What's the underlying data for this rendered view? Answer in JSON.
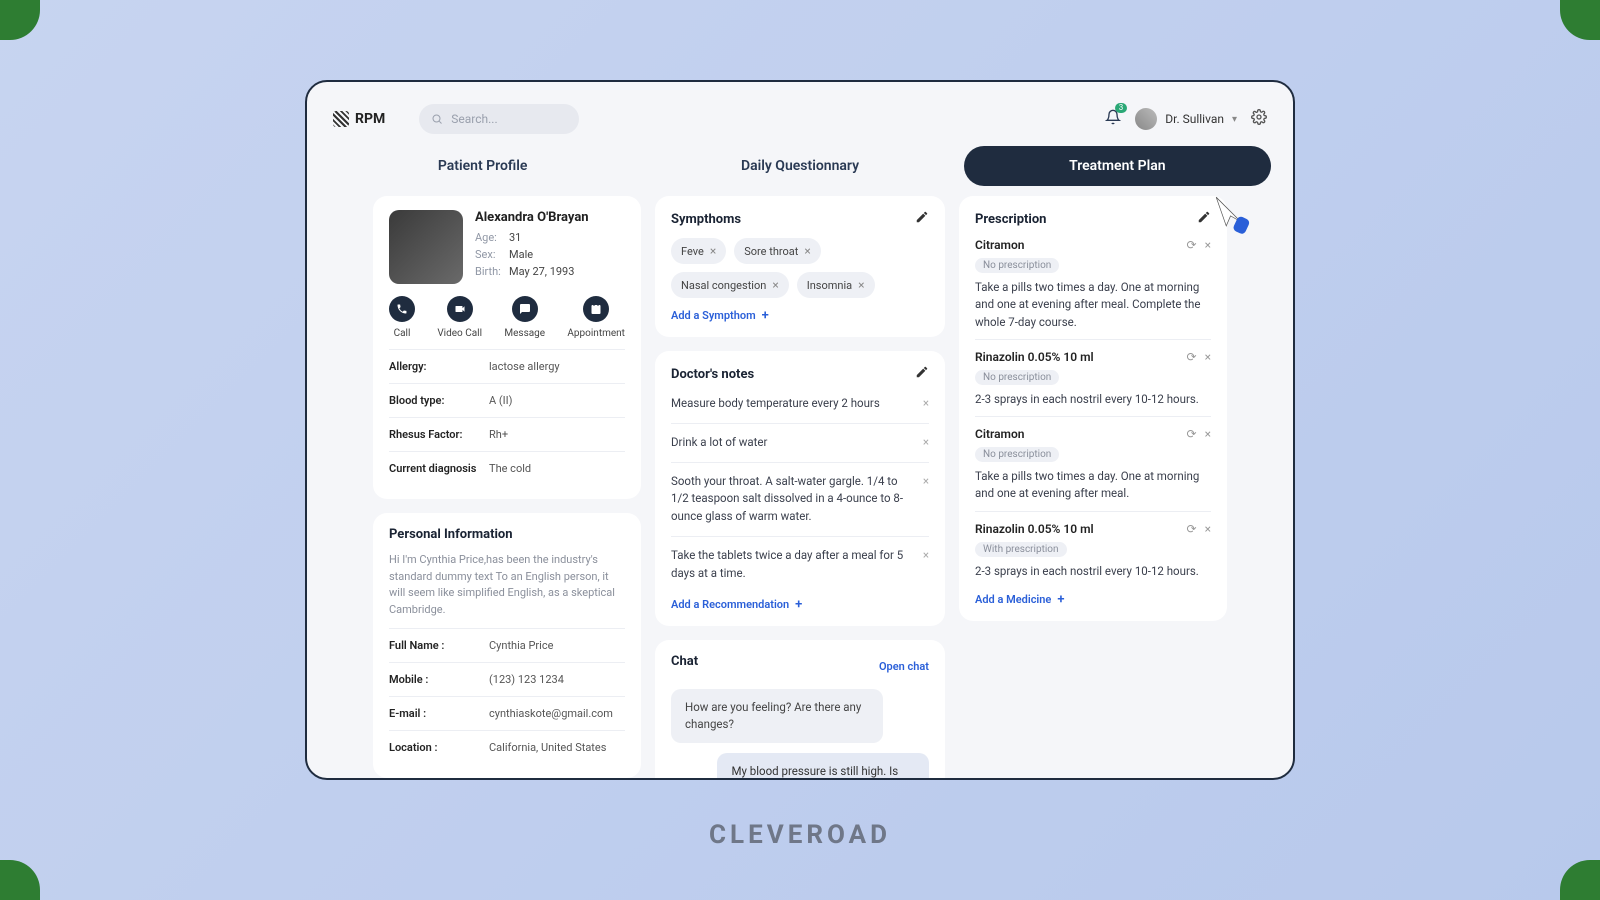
{
  "brand": "RPM",
  "search_placeholder": "Search...",
  "notifications_count": "3",
  "user_name": "Dr. Sullivan",
  "tabs": {
    "profile": "Patient Profile",
    "daily": "Daily Questionnary",
    "plan": "Treatment Plan"
  },
  "patient": {
    "name": "Alexandra O'Brayan",
    "age_label": "Age:",
    "age": "31",
    "sex_label": "Sex:",
    "sex": "Male",
    "birth_label": "Birth:",
    "birth": "May 27, 1993"
  },
  "actions": {
    "call": "Call",
    "video": "Video Call",
    "message": "Message",
    "appointment": "Appointment"
  },
  "medical": {
    "allergy_k": "Allergy:",
    "allergy_v": "lactose allergy",
    "blood_k": "Blood type:",
    "blood_v": "A (II)",
    "rh_k": "Rhesus Factor:",
    "rh_v": "Rh+",
    "diag_k": "Current diagnosis",
    "diag_v": "The cold"
  },
  "personal": {
    "title": "Personal Information",
    "blurb": "Hi I'm Cynthia Price,has been the industry's standard dummy text To an English person, it will seem like simplified English, as a skeptical Cambridge.",
    "fullname_k": "Full Name :",
    "fullname_v": "Cynthia Price",
    "mobile_k": "Mobile :",
    "mobile_v": "(123) 123 1234",
    "email_k": "E-mail :",
    "email_v": "cynthiaskote@gmail.com",
    "location_k": "Location :",
    "location_v": "California, United States"
  },
  "symptoms": {
    "title": "Sympthoms",
    "chips": [
      "Feve",
      "Sore throat",
      "Nasal congestion",
      "Insomnia"
    ],
    "add": "Add a Sympthom"
  },
  "notes": {
    "title": "Doctor's notes",
    "items": [
      "Measure body temperature every 2 hours",
      "Drink a lot of water",
      "Sooth your throat. A salt-water gargle. 1/4 to 1/2 teaspoon salt dissolved in a 4-ounce to 8-ounce glass of warm water.",
      "Take the tablets twice a day after a meal for 5 days at a time."
    ],
    "add": "Add a Recommendation"
  },
  "prescription": {
    "title": "Prescription",
    "items": [
      {
        "name": "Citramon",
        "badge": "No prescription",
        "text": "Take a pills two times a day. One at morning and one at evening after meal. Complete the whole 7-day course."
      },
      {
        "name": "Rinazolin 0.05% 10 ml",
        "badge": "No prescription",
        "text": "2-3 sprays in each nostril every 10-12 hours."
      },
      {
        "name": "Citramon",
        "badge": "No prescription",
        "text": "Take a pills two times a day. One at morning and one at evening after meal."
      },
      {
        "name": "Rinazolin 0.05% 10 ml",
        "badge": "With prescription",
        "text": "2-3 sprays in each nostril every 10-12 hours."
      }
    ],
    "add": "Add a Medicine"
  },
  "chat": {
    "title": "Chat",
    "open": "Open chat",
    "msg1": "How are you feeling? Are there any changes?",
    "msg2": "My blood pressure is still high. Is there anything else I can take to make me feel better?"
  },
  "watermark": "CLEVEROAD"
}
